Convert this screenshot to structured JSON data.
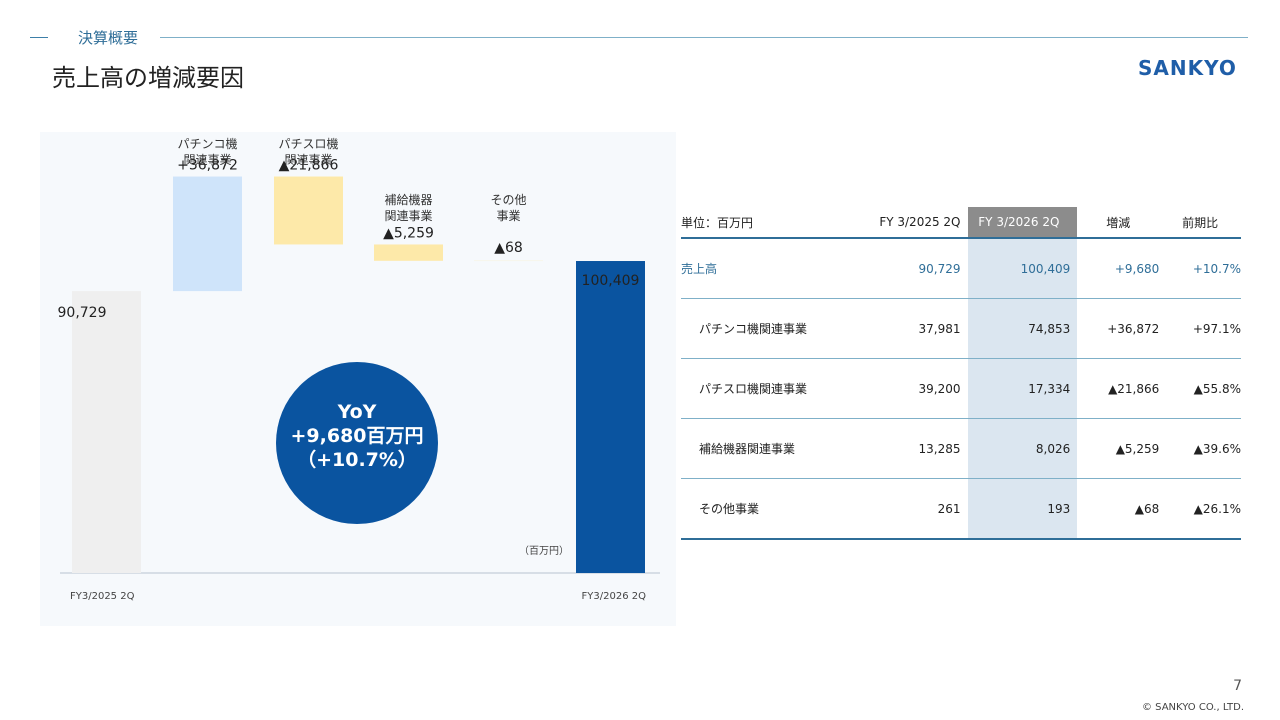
{
  "header": {
    "section": "決算概要",
    "title": "売上高の増減要因",
    "logo_text": "SANKYO"
  },
  "colors": {
    "accent": "#0a54a0",
    "base_bar": "#efefef",
    "increase_bar": "#cfe4fa",
    "decrease_bar": "#fde9a9",
    "table_highlight": "#dbe6f0"
  },
  "chart_data": {
    "type": "bar",
    "subtype": "waterfall",
    "unit": "（百万円）",
    "categories": [
      "FY3/2025 2Q",
      "パチンコ機関連事業",
      "パチスロ機関連事業",
      "補給機器関連事業",
      "その他事業",
      "FY3/2026 2Q"
    ],
    "category_labels": [
      {
        "l1": "",
        "l2": ""
      },
      {
        "l1": "パチンコ機",
        "l2": "関連事業"
      },
      {
        "l1": "パチスロ機",
        "l2": "関連事業"
      },
      {
        "l1": "補給機器",
        "l2": "関連事業"
      },
      {
        "l1": "その他",
        "l2": "事業"
      },
      {
        "l1": "",
        "l2": ""
      }
    ],
    "axis_labels": {
      "start": "FY3/2025 2Q",
      "end": "FY3/2026 2Q"
    },
    "values": [
      90729,
      36872,
      -21866,
      -5259,
      -68,
      100409
    ],
    "value_labels": [
      "90,729",
      "+36,872",
      "▲21,866",
      "▲5,259",
      "▲68",
      "100,409"
    ],
    "ylim": [
      0,
      140000
    ]
  },
  "yoy": {
    "line1": "YoY",
    "line2": "+9,680百万円",
    "line3": "（+10.7%）"
  },
  "table": {
    "headers": [
      "単位：百万円",
      "FY 3/2025 2Q",
      "FY 3/2026 2Q",
      "増減",
      "前期比"
    ],
    "rows": [
      {
        "label": "売上高",
        "fy2025": "90,729",
        "fy2026": "100,409",
        "change": "+9,680",
        "ratio": "+10.7%"
      },
      {
        "label": "パチンコ機関連事業",
        "fy2025": "37,981",
        "fy2026": "74,853",
        "change": "+36,872",
        "ratio": "+97.1%"
      },
      {
        "label": "パチスロ機関連事業",
        "fy2025": "39,200",
        "fy2026": "17,334",
        "change": "▲21,866",
        "ratio": "▲55.8%"
      },
      {
        "label": "補給機器関連事業",
        "fy2025": "13,285",
        "fy2026": "8,026",
        "change": "▲5,259",
        "ratio": "▲39.6%"
      },
      {
        "label": "その他事業",
        "fy2025": "261",
        "fy2026": "193",
        "change": "▲68",
        "ratio": "▲26.1%"
      }
    ]
  },
  "footer": {
    "page": "7",
    "copyright": "© SANKYO CO., LTD."
  }
}
